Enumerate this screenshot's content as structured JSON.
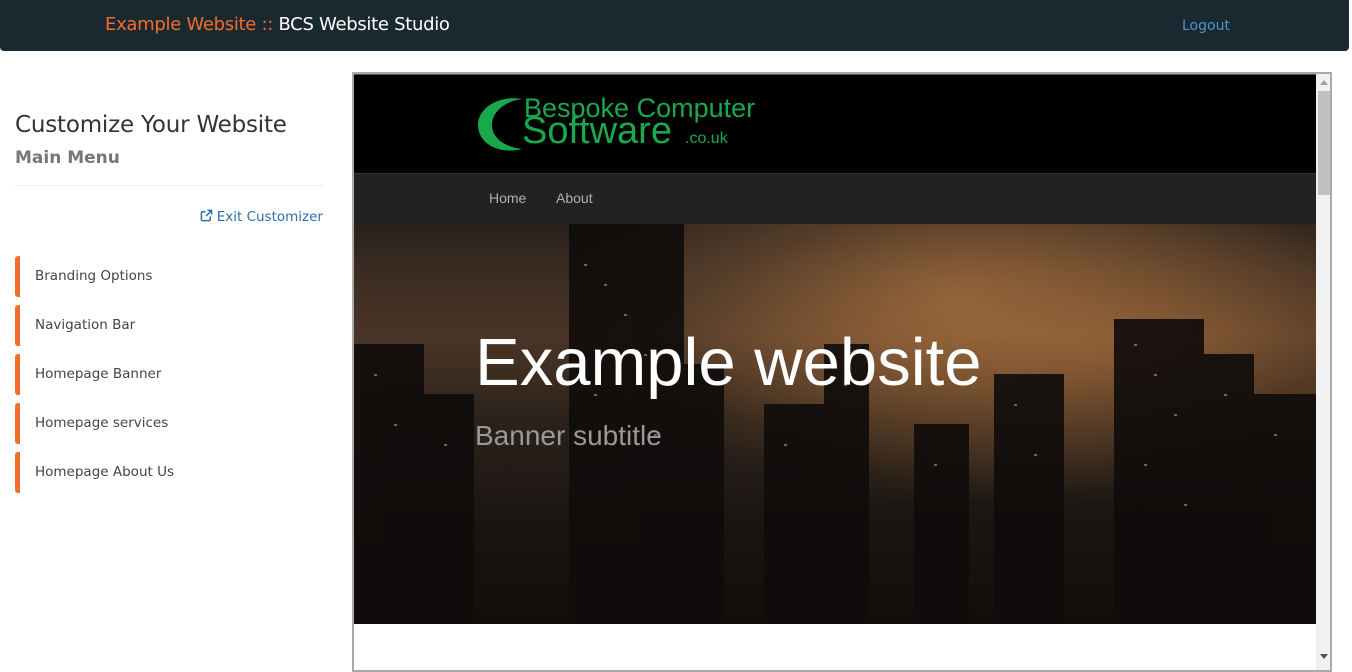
{
  "navbar": {
    "site_name": "Example Website",
    "separator": " :: ",
    "studio_name": "BCS Website Studio",
    "logout_label": "Logout"
  },
  "sidebar": {
    "title": "Customize Your Website",
    "subtitle": "Main Menu",
    "exit_label": "Exit Customizer",
    "items": [
      {
        "label": "Branding Options"
      },
      {
        "label": "Navigation Bar"
      },
      {
        "label": "Homepage Banner"
      },
      {
        "label": "Homepage services"
      },
      {
        "label": "Homepage About Us"
      }
    ]
  },
  "preview": {
    "logo": {
      "line1": "Bespoke Computer",
      "line2": "Software",
      "suffix": ".co.uk"
    },
    "nav": [
      "Home",
      "About"
    ],
    "banner": {
      "title": "Example website",
      "subtitle": "Banner subtitle"
    }
  },
  "colors": {
    "navbar_bg": "#1a2930",
    "accent": "#f26c2a",
    "link": "#2a6fab",
    "logo_green": "#1aa84d"
  },
  "icons": {
    "exit": "external-link-icon",
    "logo": "crescent-logo-icon"
  }
}
